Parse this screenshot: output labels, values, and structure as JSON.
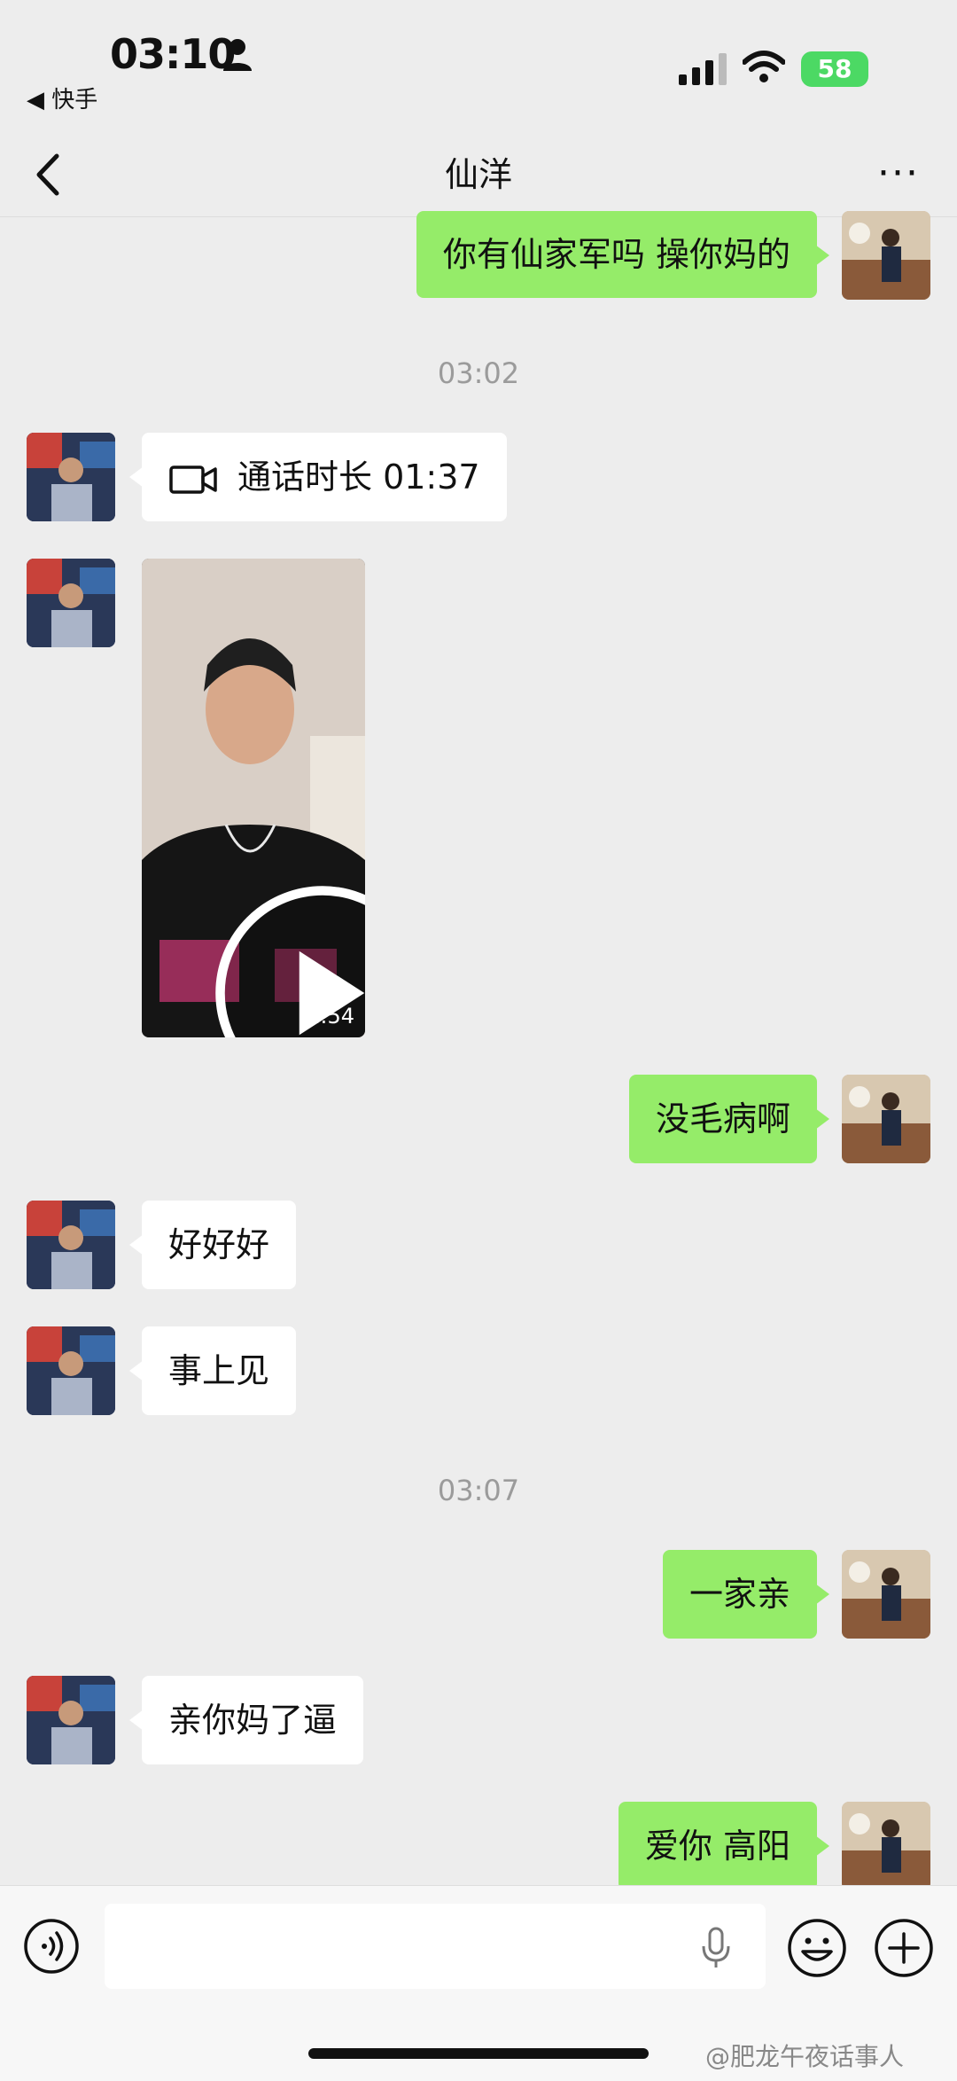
{
  "status_bar": {
    "time": "03:10",
    "back_app": "◀ 快手",
    "battery": "58"
  },
  "nav": {
    "title": "仙洋",
    "more": "···"
  },
  "messages": [
    {
      "side": "self",
      "text": "你有仙家军吗 操你妈的"
    },
    {
      "type": "timestamp",
      "text": "03:02"
    },
    {
      "side": "other",
      "type": "call",
      "text": "通话时长 01:37"
    },
    {
      "side": "other",
      "type": "video",
      "duration": "1:54"
    },
    {
      "side": "self",
      "text": "没毛病啊"
    },
    {
      "side": "other",
      "text": "好好好"
    },
    {
      "side": "other",
      "text": "事上见"
    },
    {
      "type": "timestamp",
      "text": "03:07"
    },
    {
      "side": "self",
      "text": "一家亲"
    },
    {
      "side": "other",
      "text": "亲你妈了逼"
    },
    {
      "side": "self",
      "text": "爱你 高阳"
    }
  ],
  "watermark": "@肥龙午夜话事人",
  "colors": {
    "self_bubble": "#95ec69",
    "other_bubble": "#ffffff",
    "background": "#ededed",
    "battery": "#4cd964"
  }
}
